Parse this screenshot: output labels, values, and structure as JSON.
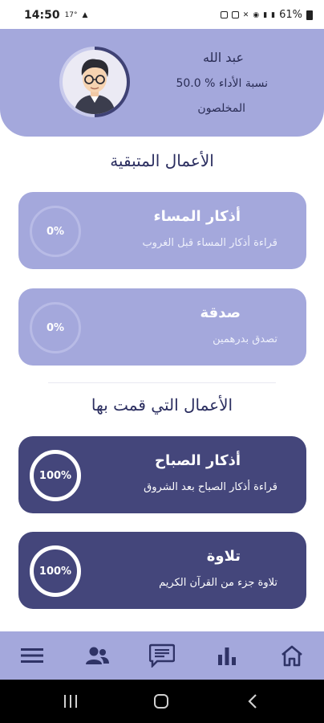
{
  "status_bar": {
    "time": "14:50",
    "temperature": "17°",
    "battery": "61%"
  },
  "profile": {
    "name": "عبد الله",
    "score": "نسبة الأداء % 50.0",
    "score_percent": 50,
    "rank": "المخلصون"
  },
  "pending": {
    "title": "الأعمال المتبقية",
    "items": [
      {
        "title": "أذكار المساء",
        "subtitle": "قراءة أذكار المساء قبل الغروب",
        "progress": "0%"
      },
      {
        "title": "صدقة",
        "subtitle": "تصدق بدرهمين",
        "progress": "0%"
      }
    ]
  },
  "done": {
    "title": "الأعمال التي قمت بها",
    "items": [
      {
        "title": "أذكار الصباح",
        "subtitle": "قراءة أذكار الصباح بعد الشروق",
        "progress": "100%"
      },
      {
        "title": "تلاوة",
        "subtitle": "تلاوة جزء من القرآن الكريم",
        "progress": "100%"
      }
    ]
  },
  "bottom_nav": {
    "items": [
      "menu-icon",
      "people-icon",
      "chat-icon",
      "bar-chart-icon",
      "home-icon"
    ]
  },
  "colors": {
    "accent_light": "#a4a8dc",
    "accent_dark": "#44467b",
    "title_text": "#2b2e60"
  }
}
